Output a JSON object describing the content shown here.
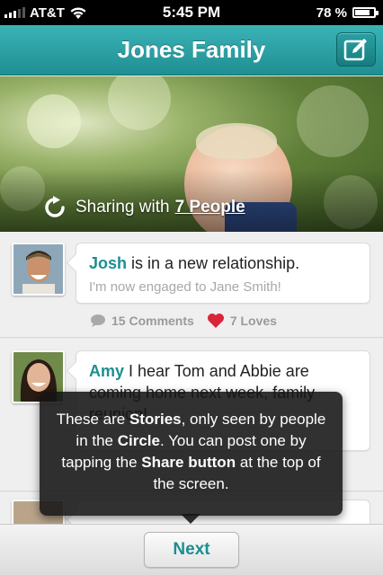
{
  "status_bar": {
    "carrier": "AT&T",
    "time": "5:45 PM",
    "battery_text": "78 %",
    "battery_level": 0.78
  },
  "nav": {
    "title": "Jones Family",
    "compose_icon": "compose-icon"
  },
  "hero": {
    "sharing_prefix": "Sharing with",
    "sharing_link": "7 People",
    "share_icon": "share-arrow-icon"
  },
  "feed": [
    {
      "name": "Josh",
      "text": " is in a new relationship.",
      "subtext": "I'm now engaged to Jane Smith!",
      "comments": "15 Comments",
      "loves": "7 Loves"
    },
    {
      "name": "Amy",
      "text": " I hear Tom and Abbie are coming home next week, family reunion!"
    }
  ],
  "tooltip": {
    "part1": "These are ",
    "bold1": "Stories",
    "part2": ", only seen by people in the ",
    "bold2": "Circle",
    "part3": ". You can post one by tapping the ",
    "bold3": "Share button",
    "part4": " at the top of the screen."
  },
  "footer": {
    "next_label": "Next"
  },
  "colors": {
    "accent": "#1f8f93",
    "love": "#d9243a"
  }
}
